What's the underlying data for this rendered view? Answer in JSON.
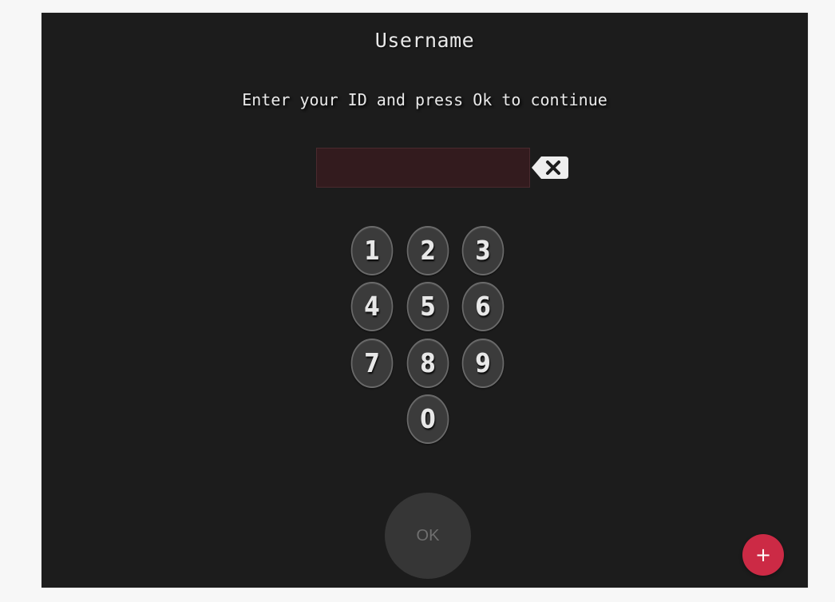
{
  "screen": {
    "title": "Username",
    "instruction": "Enter your ID and press Ok to continue"
  },
  "id_input": {
    "value": "",
    "placeholder": ""
  },
  "keypad": {
    "keys": [
      "1",
      "2",
      "3",
      "4",
      "5",
      "6",
      "7",
      "8",
      "9",
      "0"
    ]
  },
  "ok_button": {
    "label": "OK"
  },
  "fab": {
    "label": "+",
    "color": "#cc2a45"
  },
  "colors": {
    "panel_background": "#1c1c1c",
    "input_background": "#331b1e",
    "key_background": "#3b3b3b"
  },
  "icons": {
    "backspace": "backspace-icon"
  }
}
